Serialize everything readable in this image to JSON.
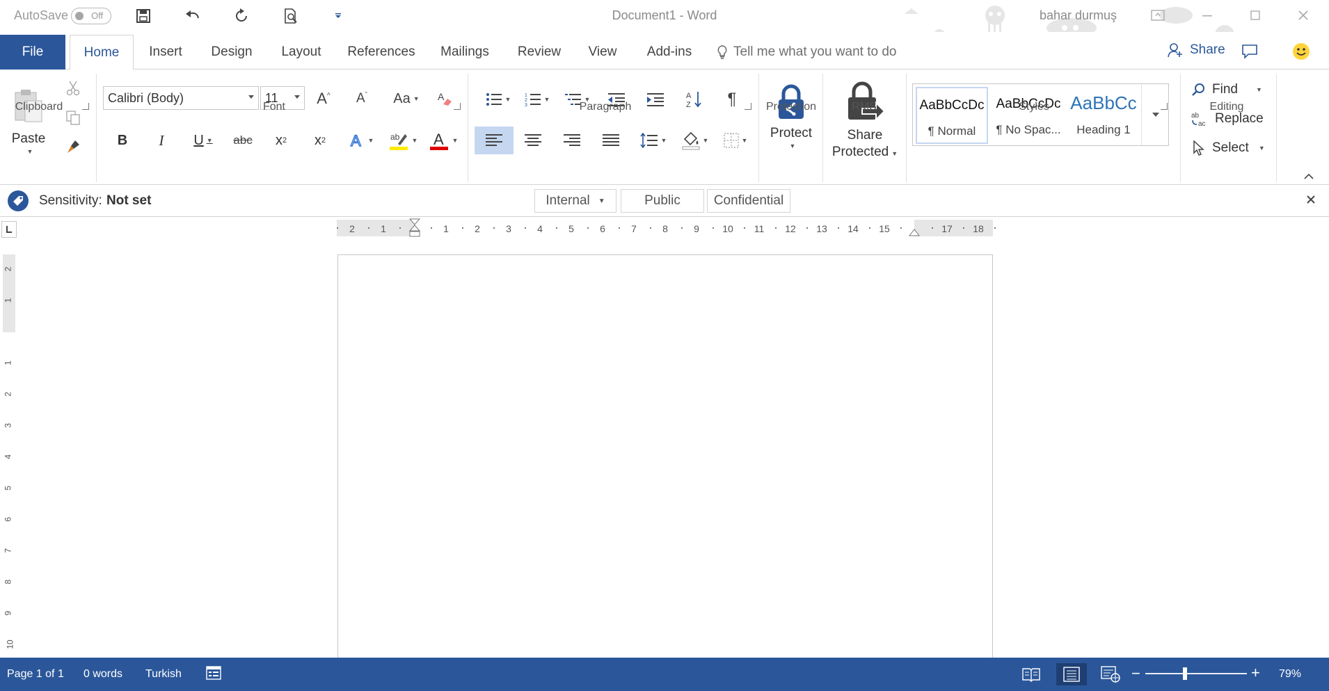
{
  "window": {
    "doc_title": "Document1  -  Word",
    "user_name": "bahar durmuş"
  },
  "quick_access": {
    "autosave_label": "AutoSave",
    "autosave_state": "Off"
  },
  "tabs": {
    "file": "File",
    "items": [
      "Home",
      "Insert",
      "Design",
      "Layout",
      "References",
      "Mailings",
      "Review",
      "View",
      "Add-ins"
    ],
    "active": "Home",
    "tell_me_placeholder": "Tell me what you want to do",
    "share_label": "Share"
  },
  "ribbon": {
    "clipboard": {
      "label": "Clipboard",
      "paste": "Paste"
    },
    "font": {
      "label": "Font",
      "font_name": "Calibri (Body)",
      "font_size": "11",
      "change_case": "Aa",
      "bold": "B",
      "italic": "I",
      "underline": "U",
      "strike": "abc",
      "subscript": "x",
      "subscript_sub": "2",
      "superscript": "x",
      "superscript_sup": "2",
      "highlight_color": "#ffeb00",
      "font_color": "#e00000"
    },
    "paragraph": {
      "label": "Paragraph"
    },
    "protection": {
      "label": "Protection",
      "protect": "Protect"
    },
    "rms": {
      "label": "RMS",
      "share_protected_line1": "Share",
      "share_protected_line2": "Protected"
    },
    "styles": {
      "label": "Styles",
      "items": [
        {
          "sample": "AaBbCcDc",
          "name": "¶ Normal"
        },
        {
          "sample": "AaBbCcDc",
          "name": "¶ No Spac..."
        },
        {
          "sample": "AaBbCc",
          "name": "Heading 1"
        }
      ]
    },
    "editing": {
      "label": "Editing",
      "find": "Find",
      "replace": "Replace",
      "select": "Select"
    }
  },
  "sensitivity": {
    "label": "Sensitivity:",
    "value": "Not set",
    "options": [
      "Internal",
      "Public",
      "Confidential"
    ]
  },
  "ruler": {
    "horizontal": [
      "2",
      "1",
      "1",
      "2",
      "3",
      "4",
      "5",
      "6",
      "7",
      "8",
      "9",
      "10",
      "11",
      "12",
      "13",
      "14",
      "15",
      "17",
      "18"
    ],
    "vertical": [
      "2",
      "1",
      "1",
      "2",
      "3",
      "4",
      "5",
      "6",
      "7",
      "8",
      "9",
      "10"
    ]
  },
  "status": {
    "page": "Page 1 of 1",
    "words": "0 words",
    "language": "Turkish",
    "zoom": "79%",
    "zoom_minus": "−",
    "zoom_plus": "+"
  },
  "colors": {
    "accent": "#2b579a",
    "status_bar": "#2b579a"
  }
}
